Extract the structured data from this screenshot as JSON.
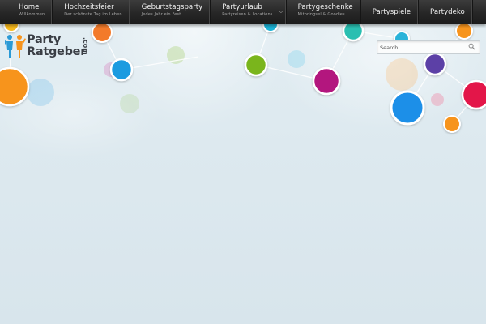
{
  "nav": {
    "items": [
      {
        "label": "Home",
        "subtitle": "Willkommen",
        "has_submenu": false
      },
      {
        "label": "Hochzeitsfeier",
        "subtitle": "Der schönste Tag im Leben",
        "has_submenu": false
      },
      {
        "label": "Geburtstagsparty",
        "subtitle": "Jedes Jahr ein Fest",
        "has_submenu": false
      },
      {
        "label": "Partyurlaub",
        "subtitle": "Partyreisen & Locations",
        "has_submenu": true
      },
      {
        "label": "Partygeschenke",
        "subtitle": "Mitbringsel & Goodies",
        "has_submenu": false
      },
      {
        "label": "Partyspiele",
        "subtitle": "",
        "has_submenu": false
      },
      {
        "label": "Partydeko",
        "subtitle": "",
        "has_submenu": false
      }
    ]
  },
  "logo": {
    "line1": "Party",
    "line2": "Ratgeber",
    "suffix": ".com",
    "icon": "people-icon"
  },
  "search": {
    "placeholder": "Search",
    "icon": "magnifier-icon"
  },
  "colors": {
    "navbar": "#262626",
    "background": "#dfeaf0",
    "logo_text": "#3a3e45",
    "bubble_orange": "#f7941d",
    "bubble_blue": "#1b9be0",
    "bubble_teal": "#2bbfb1",
    "bubble_green": "#7ab51d",
    "bubble_magenta": "#b3127e",
    "bubble_purple": "#5b3fa6",
    "bubble_red": "#e3174a"
  }
}
